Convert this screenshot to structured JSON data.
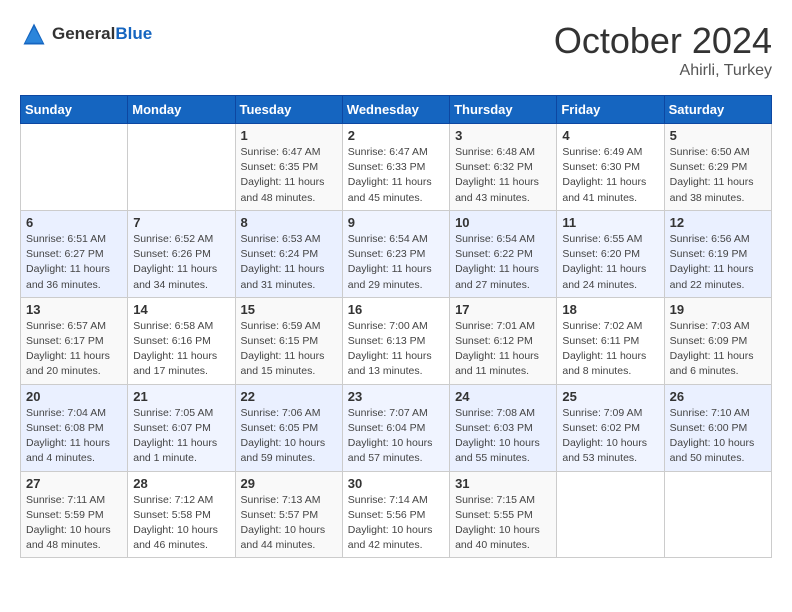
{
  "header": {
    "logo_general": "General",
    "logo_blue": "Blue",
    "month": "October 2024",
    "location": "Ahirli, Turkey"
  },
  "days_of_week": [
    "Sunday",
    "Monday",
    "Tuesday",
    "Wednesday",
    "Thursday",
    "Friday",
    "Saturday"
  ],
  "weeks": [
    [
      {
        "day": "",
        "info": ""
      },
      {
        "day": "",
        "info": ""
      },
      {
        "day": "1",
        "info": "Sunrise: 6:47 AM\nSunset: 6:35 PM\nDaylight: 11 hours and 48 minutes."
      },
      {
        "day": "2",
        "info": "Sunrise: 6:47 AM\nSunset: 6:33 PM\nDaylight: 11 hours and 45 minutes."
      },
      {
        "day": "3",
        "info": "Sunrise: 6:48 AM\nSunset: 6:32 PM\nDaylight: 11 hours and 43 minutes."
      },
      {
        "day": "4",
        "info": "Sunrise: 6:49 AM\nSunset: 6:30 PM\nDaylight: 11 hours and 41 minutes."
      },
      {
        "day": "5",
        "info": "Sunrise: 6:50 AM\nSunset: 6:29 PM\nDaylight: 11 hours and 38 minutes."
      }
    ],
    [
      {
        "day": "6",
        "info": "Sunrise: 6:51 AM\nSunset: 6:27 PM\nDaylight: 11 hours and 36 minutes."
      },
      {
        "day": "7",
        "info": "Sunrise: 6:52 AM\nSunset: 6:26 PM\nDaylight: 11 hours and 34 minutes."
      },
      {
        "day": "8",
        "info": "Sunrise: 6:53 AM\nSunset: 6:24 PM\nDaylight: 11 hours and 31 minutes."
      },
      {
        "day": "9",
        "info": "Sunrise: 6:54 AM\nSunset: 6:23 PM\nDaylight: 11 hours and 29 minutes."
      },
      {
        "day": "10",
        "info": "Sunrise: 6:54 AM\nSunset: 6:22 PM\nDaylight: 11 hours and 27 minutes."
      },
      {
        "day": "11",
        "info": "Sunrise: 6:55 AM\nSunset: 6:20 PM\nDaylight: 11 hours and 24 minutes."
      },
      {
        "day": "12",
        "info": "Sunrise: 6:56 AM\nSunset: 6:19 PM\nDaylight: 11 hours and 22 minutes."
      }
    ],
    [
      {
        "day": "13",
        "info": "Sunrise: 6:57 AM\nSunset: 6:17 PM\nDaylight: 11 hours and 20 minutes."
      },
      {
        "day": "14",
        "info": "Sunrise: 6:58 AM\nSunset: 6:16 PM\nDaylight: 11 hours and 17 minutes."
      },
      {
        "day": "15",
        "info": "Sunrise: 6:59 AM\nSunset: 6:15 PM\nDaylight: 11 hours and 15 minutes."
      },
      {
        "day": "16",
        "info": "Sunrise: 7:00 AM\nSunset: 6:13 PM\nDaylight: 11 hours and 13 minutes."
      },
      {
        "day": "17",
        "info": "Sunrise: 7:01 AM\nSunset: 6:12 PM\nDaylight: 11 hours and 11 minutes."
      },
      {
        "day": "18",
        "info": "Sunrise: 7:02 AM\nSunset: 6:11 PM\nDaylight: 11 hours and 8 minutes."
      },
      {
        "day": "19",
        "info": "Sunrise: 7:03 AM\nSunset: 6:09 PM\nDaylight: 11 hours and 6 minutes."
      }
    ],
    [
      {
        "day": "20",
        "info": "Sunrise: 7:04 AM\nSunset: 6:08 PM\nDaylight: 11 hours and 4 minutes."
      },
      {
        "day": "21",
        "info": "Sunrise: 7:05 AM\nSunset: 6:07 PM\nDaylight: 11 hours and 1 minute."
      },
      {
        "day": "22",
        "info": "Sunrise: 7:06 AM\nSunset: 6:05 PM\nDaylight: 10 hours and 59 minutes."
      },
      {
        "day": "23",
        "info": "Sunrise: 7:07 AM\nSunset: 6:04 PM\nDaylight: 10 hours and 57 minutes."
      },
      {
        "day": "24",
        "info": "Sunrise: 7:08 AM\nSunset: 6:03 PM\nDaylight: 10 hours and 55 minutes."
      },
      {
        "day": "25",
        "info": "Sunrise: 7:09 AM\nSunset: 6:02 PM\nDaylight: 10 hours and 53 minutes."
      },
      {
        "day": "26",
        "info": "Sunrise: 7:10 AM\nSunset: 6:00 PM\nDaylight: 10 hours and 50 minutes."
      }
    ],
    [
      {
        "day": "27",
        "info": "Sunrise: 7:11 AM\nSunset: 5:59 PM\nDaylight: 10 hours and 48 minutes."
      },
      {
        "day": "28",
        "info": "Sunrise: 7:12 AM\nSunset: 5:58 PM\nDaylight: 10 hours and 46 minutes."
      },
      {
        "day": "29",
        "info": "Sunrise: 7:13 AM\nSunset: 5:57 PM\nDaylight: 10 hours and 44 minutes."
      },
      {
        "day": "30",
        "info": "Sunrise: 7:14 AM\nSunset: 5:56 PM\nDaylight: 10 hours and 42 minutes."
      },
      {
        "day": "31",
        "info": "Sunrise: 7:15 AM\nSunset: 5:55 PM\nDaylight: 10 hours and 40 minutes."
      },
      {
        "day": "",
        "info": ""
      },
      {
        "day": "",
        "info": ""
      }
    ]
  ]
}
